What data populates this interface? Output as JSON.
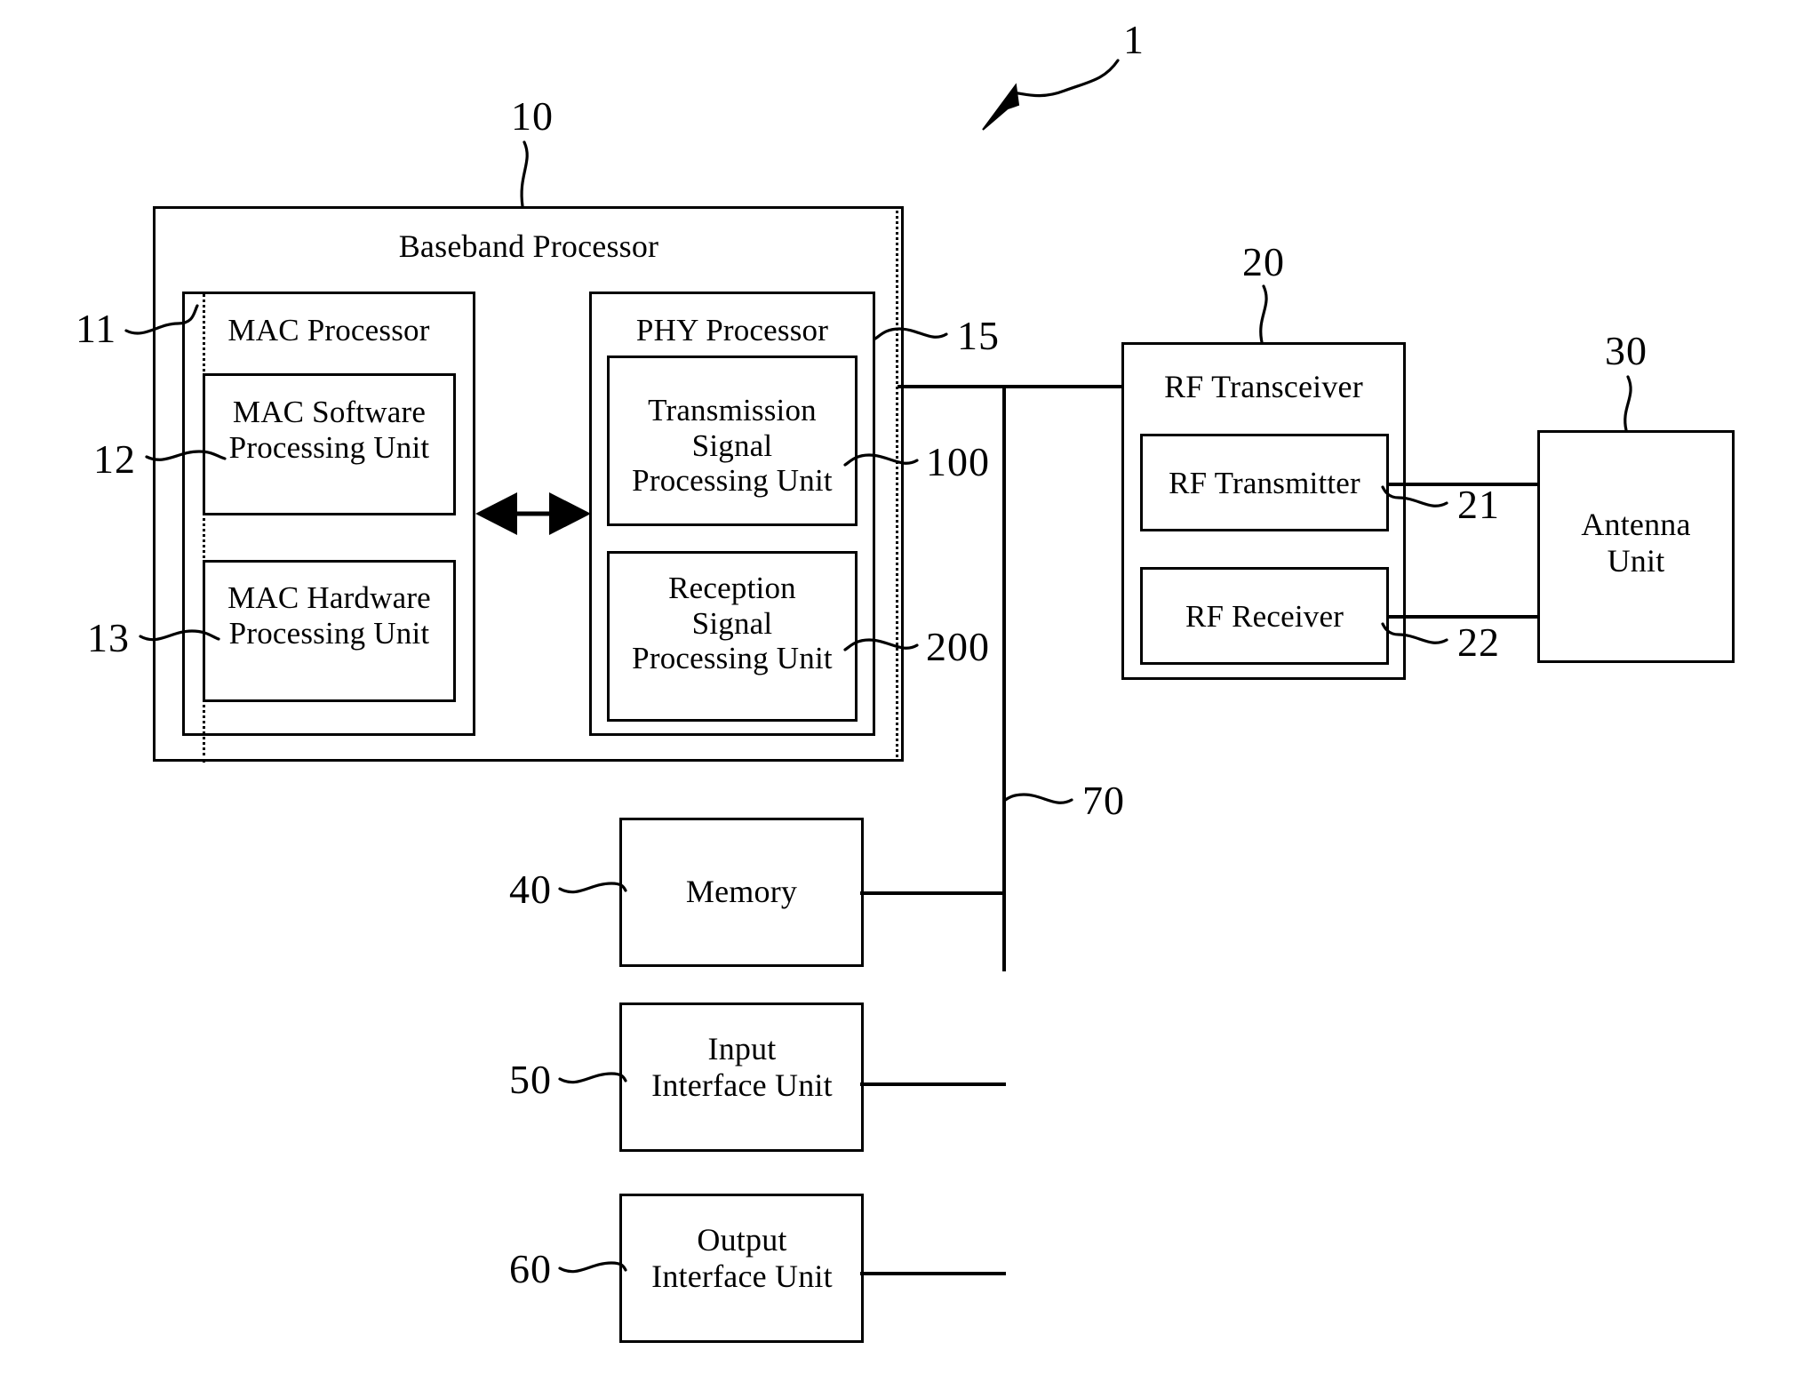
{
  "figure": {
    "overall_ref": "1",
    "blocks": {
      "baseband_processor": {
        "title": "Baseband Processor",
        "ref": "10"
      },
      "mac_processor": {
        "title": "MAC Processor",
        "ref": "11"
      },
      "mac_software_processing_unit": {
        "title": "MAC Software\nProcessing Unit",
        "ref": "12"
      },
      "mac_hardware_processing_unit": {
        "title": "MAC Hardware\nProcessing Unit",
        "ref": "13"
      },
      "phy_processor": {
        "title": "PHY Processor",
        "ref": "15"
      },
      "transmission_signal_processing_unit": {
        "title": "Transmission\nSignal\nProcessing Unit",
        "ref": "100"
      },
      "reception_signal_processing_unit": {
        "title": "Reception\nSignal\nProcessing Unit",
        "ref": "200"
      },
      "rf_transceiver": {
        "title": "RF Transceiver",
        "ref": "20"
      },
      "rf_transmitter": {
        "title": "RF Transmitter",
        "ref": "21"
      },
      "rf_receiver": {
        "title": "RF Receiver",
        "ref": "22"
      },
      "antenna_unit": {
        "title": "Antenna\nUnit",
        "ref": "30"
      },
      "memory": {
        "title": "Memory",
        "ref": "40"
      },
      "input_interface_unit": {
        "title": "Input\nInterface Unit",
        "ref": "50"
      },
      "output_interface_unit": {
        "title": "Output\nInterface Unit",
        "ref": "60"
      },
      "bus": {
        "ref": "70"
      }
    }
  }
}
